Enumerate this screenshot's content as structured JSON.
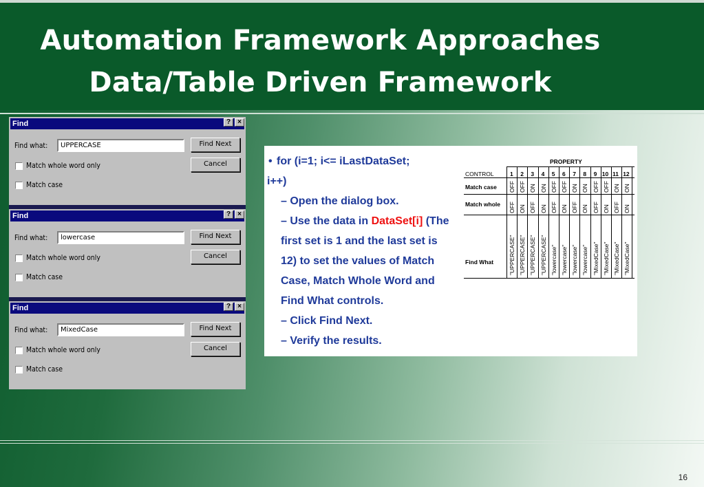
{
  "slide": {
    "title_line1": "Automation Framework Approaches",
    "title_line2": "Data/Table Driven Framework",
    "page_number": "16"
  },
  "dialogs": [
    {
      "title": "Find",
      "find_what_label": "Find what:",
      "find_what_value": "UPPERCASE",
      "find_next": "Find Next",
      "cancel": "Cancel",
      "match_whole": "Match whole word only",
      "match_case": "Match case",
      "help": "?",
      "close": "×"
    },
    {
      "title": "Find",
      "find_what_label": "Find what:",
      "find_what_value": "lowercase",
      "find_next": "Find Next",
      "cancel": "Cancel",
      "match_whole": "Match whole word only",
      "match_case": "Match case",
      "help": "?",
      "close": "×"
    },
    {
      "title": "Find",
      "find_what_label": "Find what:",
      "find_what_value": "MixedCase",
      "find_next": "Find Next",
      "cancel": "Cancel",
      "match_whole": "Match whole word only",
      "match_case": "Match case",
      "help": "?",
      "close": "×"
    }
  ],
  "panel": {
    "bullet": "•",
    "line1": "for (i=1; i<= iLastDataSet;",
    "line2": "i++)",
    "step1": "– Open the dialog box.",
    "step2_pre": "– Use the data in ",
    "step2_red": "DataSet[i]",
    "step2_post": " (The",
    "step2_l2": "first set is 1 and the last set is",
    "step2_l3": "12) to set the values of Match",
    "step2_l4": "Case, Match Whole Word and",
    "step2_l5": "Find What controls.",
    "step3": "– Click Find Next.",
    "step4": "– Verify the results."
  },
  "property_table": {
    "property_header": "PROPERTY",
    "control_header": "CONTROL",
    "columns": [
      "1",
      "2",
      "3",
      "4",
      "5",
      "6",
      "7",
      "8",
      "9",
      "10",
      "11",
      "12"
    ],
    "rows": [
      {
        "label": "Match case",
        "values": [
          "OFF",
          "OFF",
          "ON",
          "ON",
          "OFF",
          "OFF",
          "ON",
          "ON",
          "OFF",
          "OFF",
          "ON",
          "ON"
        ]
      },
      {
        "label": "Match whole",
        "values": [
          "OFF",
          "ON",
          "OFF",
          "ON",
          "OFF",
          "ON",
          "OFF",
          "ON",
          "OFF",
          "ON",
          "OFF",
          "ON"
        ]
      },
      {
        "label": "Find What",
        "values": [
          "\"UPPERCASE\"",
          "\"UPPERCASE\"",
          "\"UPPERCASE\"",
          "\"UPPERCASE\"",
          "\"lowercase\"",
          "\"lowercase\"",
          "\"lowercase\"",
          "\"lowercase\"",
          "\"MixedCase\"",
          "\"MixedCase\"",
          "\"MixedCase\"",
          "\"MixedCase\""
        ]
      }
    ]
  }
}
